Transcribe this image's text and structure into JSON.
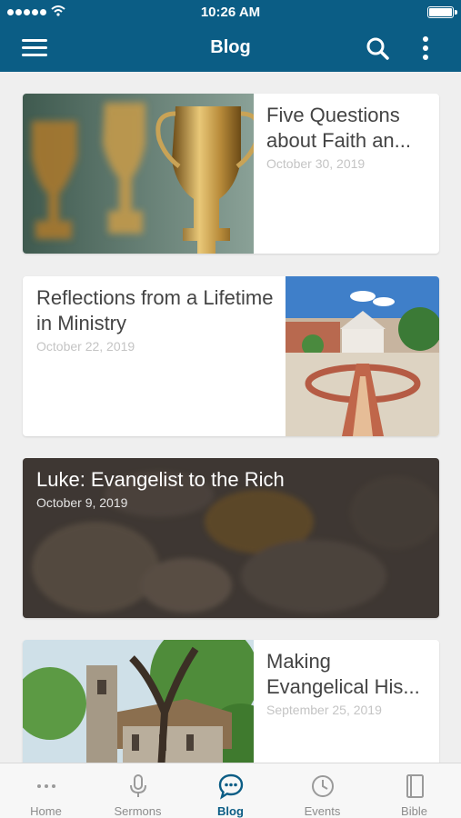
{
  "status_bar": {
    "time": "10:26 AM"
  },
  "app_bar": {
    "title": "Blog"
  },
  "posts": [
    {
      "title": "Five Questions about Faith an...",
      "date": "October 30, 2019",
      "image": "trophies-photo"
    },
    {
      "title": "Reflections from a Lifetime in Ministry",
      "date": "October 22, 2019",
      "image": "campus-plaza-photo"
    },
    {
      "title": "Luke: Evangelist to the Rich",
      "date": "October 9, 2019",
      "image": "fresco-background-photo"
    },
    {
      "title": "Making Evangelical His...",
      "date": "September 25, 2019",
      "image": "stone-church-photo"
    }
  ],
  "tabs": [
    {
      "label": "Home",
      "icon": "more-dots-icon"
    },
    {
      "label": "Sermons",
      "icon": "microphone-icon"
    },
    {
      "label": "Blog",
      "icon": "chat-bubble-icon",
      "active": true
    },
    {
      "label": "Events",
      "icon": "clock-icon"
    },
    {
      "label": "Bible",
      "icon": "book-icon"
    }
  ],
  "colors": {
    "primary": "#0b5d85",
    "inactive_tab": "#8c8c8c",
    "background": "#efefef"
  }
}
